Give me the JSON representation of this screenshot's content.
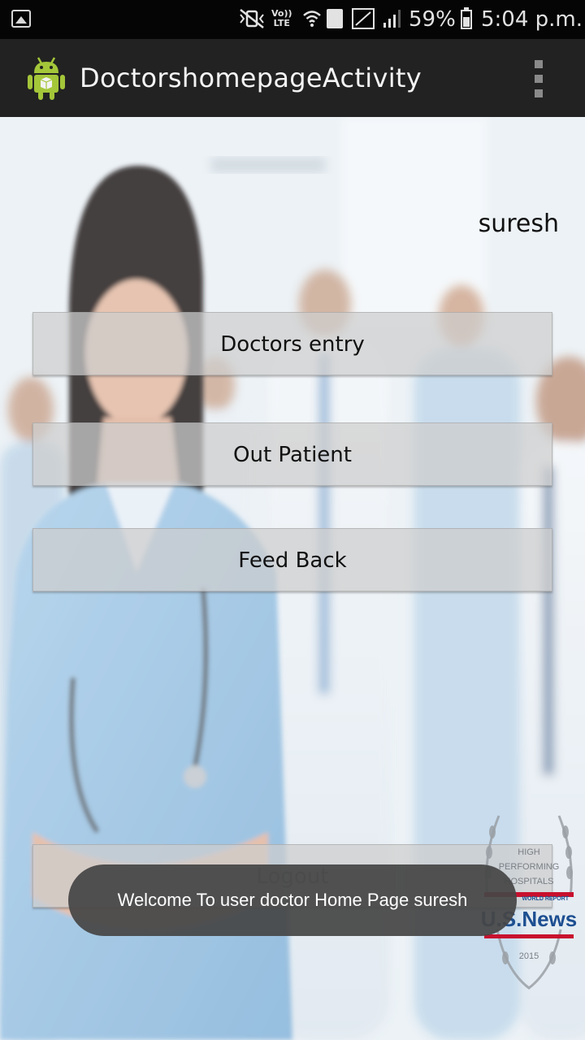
{
  "status_bar": {
    "volte_line1": "Vo))",
    "volte_line2": "LTE",
    "sim_slot": "1",
    "battery_percent_text": "59%",
    "battery_level": 0.59,
    "time": "5:04 p.m."
  },
  "action_bar": {
    "title": "DoctorshomepageActivity"
  },
  "main": {
    "username": "suresh",
    "buttons": {
      "doctors_entry": "Doctors entry",
      "out_patient": "Out Patient",
      "feed_back": "Feed Back",
      "logout": "Logout"
    }
  },
  "toast": {
    "message": "Welcome To user doctor Home Page suresh"
  },
  "badge": {
    "line1": "HIGH",
    "line2": "PERFORMING",
    "line3": "HOSPITALS",
    "brand": "U.S.News",
    "report": "WORLD REPORT",
    "year": "2015"
  },
  "colors": {
    "status_bar_bg": "#050505",
    "action_bar_bg": "#222222",
    "button_bg": "#cdcdcd",
    "toast_bg": "#464646",
    "badge_red": "#c8102e",
    "badge_blue": "#1d4f91"
  }
}
